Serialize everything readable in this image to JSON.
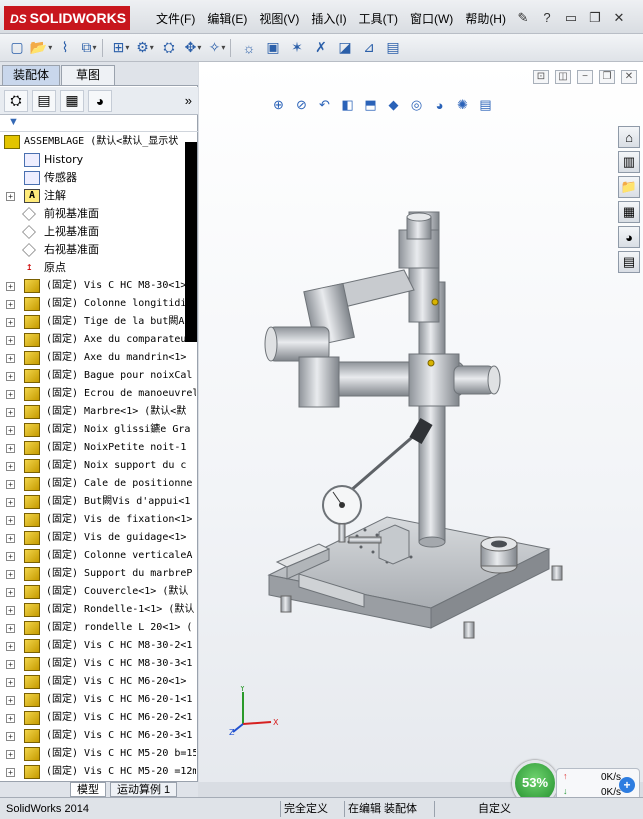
{
  "titlebar": {
    "brand_prefix": "DS",
    "brand": "SOLIDWORKS",
    "menus": [
      "文件(F)",
      "编辑(E)",
      "视图(V)",
      "插入(I)",
      "工具(T)",
      "窗口(W)",
      "帮助(H)"
    ],
    "icons": [
      "pin-icon",
      "help-icon",
      "minimize-icon",
      "restore-icon",
      "close-icon"
    ]
  },
  "left_panel": {
    "tabs": [
      "装配体",
      "草图"
    ],
    "bottom_tabs": [
      "模型",
      "运动算例 1"
    ],
    "tree": [
      {
        "kind": "asm",
        "label": "ASSEMBLAGE  (默认<默认_显示状"
      },
      {
        "kind": "hist",
        "label": "History"
      },
      {
        "kind": "sens",
        "label": "传感器"
      },
      {
        "kind": "annot",
        "label": "注解"
      },
      {
        "kind": "plane",
        "label": "前视基准面"
      },
      {
        "kind": "plane",
        "label": "上视基准面"
      },
      {
        "kind": "plane",
        "label": "右视基准面"
      },
      {
        "kind": "origin",
        "label": "原点"
      },
      {
        "kind": "part",
        "label": "(固定) Vis C HC M8-30<1>"
      },
      {
        "kind": "part",
        "label": "(固定) Colonne longitidin"
      },
      {
        "kind": "part",
        "label": "(固定) Tige de la but闕Ax"
      },
      {
        "kind": "part",
        "label": "(固定) Axe du comparateur"
      },
      {
        "kind": "part",
        "label": "(固定) Axe du mandrin<1>"
      },
      {
        "kind": "part",
        "label": "(固定) Bague pour noixCal"
      },
      {
        "kind": "part",
        "label": "(固定) Ecrou de manoeuvrel"
      },
      {
        "kind": "part",
        "label": "(固定) Marbre<1> (默认<默"
      },
      {
        "kind": "part",
        "label": "(固定) Noix glissi鑣e Gra"
      },
      {
        "kind": "part",
        "label": "(固定) NoixPetite noit-1"
      },
      {
        "kind": "part",
        "label": "(固定) Noix support  du c"
      },
      {
        "kind": "part",
        "label": "(固定) Cale de positionne"
      },
      {
        "kind": "part",
        "label": "(固定) But闕Vis d'appui<1"
      },
      {
        "kind": "part",
        "label": "(固定) Vis de fixation<1>"
      },
      {
        "kind": "part",
        "label": "(固定) Vis de guidage<1>"
      },
      {
        "kind": "part",
        "label": "(固定) Colonne verticaleA"
      },
      {
        "kind": "part",
        "label": "(固定) Support du marbreP"
      },
      {
        "kind": "part",
        "label": "(固定) Couvercle<1> (默认"
      },
      {
        "kind": "part",
        "label": "(固定) Rondelle-1<1> (默认"
      },
      {
        "kind": "part",
        "label": "(固定) rondelle L 20<1> ("
      },
      {
        "kind": "part",
        "label": "(固定) Vis C HC M8-30-2<1"
      },
      {
        "kind": "part",
        "label": "(固定) Vis C HC M8-30-3<1"
      },
      {
        "kind": "part",
        "label": "(固定) Vis C HC M6-20<1>"
      },
      {
        "kind": "part",
        "label": "(固定) Vis C HC M6-20-1<1"
      },
      {
        "kind": "part",
        "label": "(固定) Vis C HC M6-20-2<1"
      },
      {
        "kind": "part",
        "label": "(固定) Vis C HC M6-20-3<1"
      },
      {
        "kind": "part",
        "label": "(固定) Vis C HC M5-20 b=15"
      },
      {
        "kind": "part",
        "label": "(固定) Vis C HC M5-20 =12m"
      }
    ]
  },
  "viewport": {
    "triad_labels": {
      "x": "X",
      "y": "Y",
      "z": "Z"
    }
  },
  "statusbar": {
    "app": "SolidWorks 2014",
    "definition": "完全定义",
    "editing": "在编辑 装配体",
    "custom": "自定义"
  },
  "network": {
    "percent": "53%",
    "upload": "0K/s",
    "download": "0K/s",
    "plus": "+"
  }
}
